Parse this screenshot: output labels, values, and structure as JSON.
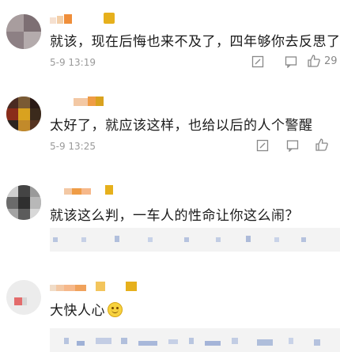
{
  "comments": [
    {
      "text": "就该，现在后悔也来不及了，四年够你去反思了。",
      "time": "5-9 13:19",
      "likes": "29",
      "avatar_icon": "blurred-avatar-gray"
    },
    {
      "text": "太好了，就应该这样，也给以后的人个警醒",
      "time": "5-9 13:25",
      "likes": "",
      "avatar_icon": "blurred-avatar-yellow"
    },
    {
      "text": "就该这么判，一车人的性命让你这么闹？",
      "time": "",
      "likes": "",
      "avatar_icon": "blurred-avatar-gray"
    },
    {
      "text": "大快人心",
      "time": "",
      "likes": "",
      "avatar_icon": "blurred-avatar-white"
    }
  ],
  "icons": {
    "edit": "edit-icon",
    "comment": "comment-icon",
    "like": "thumbs-up-icon",
    "emoji": "smile-emoji-icon"
  },
  "colors": {
    "text": "#1a1a1a",
    "meta": "#9a9a9a",
    "reply_bg": "#f3f3f3",
    "name_mosaic_orange": "#f0a24a",
    "name_mosaic_gold": "#e8b81e"
  }
}
